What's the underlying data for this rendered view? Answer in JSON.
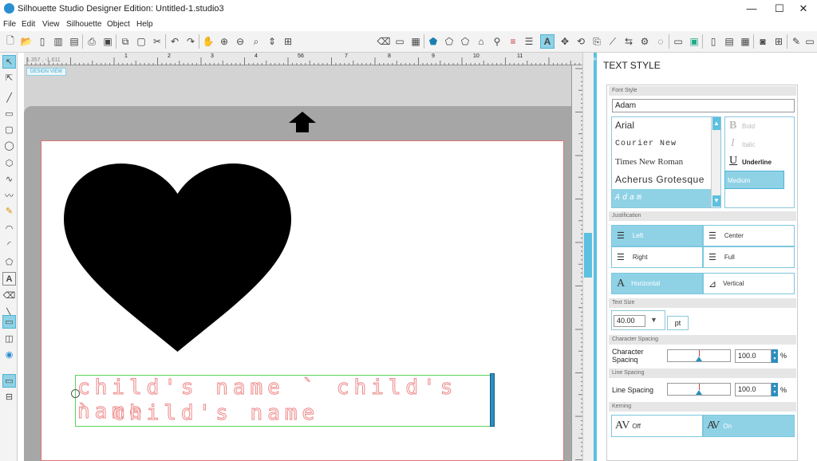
{
  "window": {
    "title": "Silhouette Studio Designer Edition: Untitled-1.studio3",
    "minimize": "—",
    "maximize": "☐",
    "close": "✕"
  },
  "menu": [
    "File",
    "Edit",
    "View",
    "Silhouette",
    "Object",
    "Help"
  ],
  "ruler": {
    "ticks": [
      "1",
      "2",
      "3",
      "4",
      "5",
      "6",
      "7",
      "8",
      "9",
      "10",
      "11"
    ],
    "readout": "1.357 , -1.611"
  },
  "canvas": {
    "design_view": "DESIGN VIEW",
    "text_line1": "child's name ` child's name",
    "text_line2": "` child's name"
  },
  "panel": {
    "title": "TEXT STYLE",
    "font_style_label": "Font Style",
    "font_value": "Adam",
    "fonts": [
      "Arial",
      "Courier New",
      "Times New Roman",
      "Acherus Grotesque",
      "Adam"
    ],
    "styles": {
      "bold": "Bold",
      "italic": "Italic",
      "underline": "Underline",
      "medium": "Medium"
    },
    "justification_label": "Justification",
    "justify": {
      "left": "Left",
      "center": "Center",
      "right": "Right",
      "full": "Full"
    },
    "direction": {
      "horizontal": "Horizontal",
      "vertical": "Vertical"
    },
    "text_size_label": "Text Size",
    "text_size": "40.00",
    "text_size_unit": "pt",
    "char_spacing_label": "Character Spacing",
    "char_spacing_name": "Character Spacinq",
    "char_spacing_value": "100.0",
    "line_spacing_label": "Line Spacing",
    "line_spacing_name": "Line Spacing",
    "line_spacing_value": "100.0",
    "percent": "%",
    "kerning_label": "Kerning",
    "kerning": {
      "off": "Off",
      "on": "On"
    }
  }
}
